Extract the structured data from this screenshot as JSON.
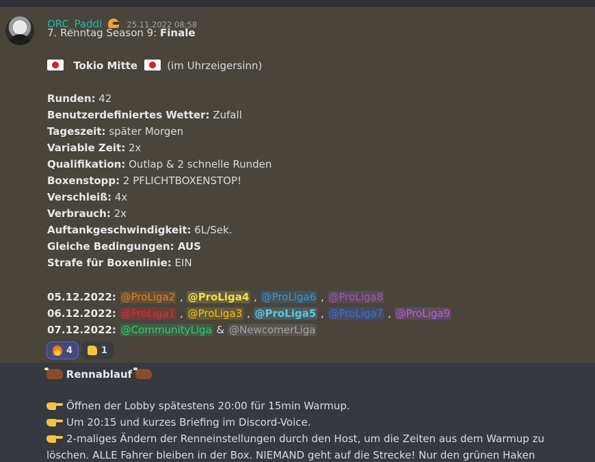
{
  "message1": {
    "username": "ORC_Paddi",
    "timestamp": "25.11.2022 08:58",
    "title_prefix": "7. Renntag Season 9: ",
    "title_bold": "Finale",
    "track": "Tokio Mitte",
    "direction": "(im Uhrzeigersinn)",
    "settings": [
      {
        "label": "Runden:",
        "value": " 42",
        "bold_value": false
      },
      {
        "label": "Benutzerdefiniertes Wetter:",
        "value": " Zufall",
        "bold_value": false
      },
      {
        "label": "Tageszeit:",
        "value": " später Morgen",
        "bold_value": false
      },
      {
        "label": "Variable Zeit:",
        "value": " 2x",
        "bold_value": false
      },
      {
        "label": "Qualifikation:",
        "value": " Outlap & 2 schnelle Runden",
        "bold_value": false
      },
      {
        "label": "Boxenstopp:",
        "value": " 2 PFLICHTBOXENSTOP!",
        "bold_value": false
      },
      {
        "label": "Verschleiß:",
        "value": " 4x",
        "bold_value": false
      },
      {
        "label": "Verbrauch:",
        "value": " 2x",
        "bold_value": false
      },
      {
        "label": "Auftankgeschwindigkeit:",
        "value": " 6L/Sek.",
        "bold_value": false
      },
      {
        "label": "Gleiche Bedingungen:",
        "value": " AUS",
        "bold_value": true
      },
      {
        "label": "Strafe für Boxenlinie:",
        "value": " EIN",
        "bold_value": false
      }
    ],
    "schedule": [
      {
        "date": "05.12.2022:",
        "mentions": [
          "@ProLiga2",
          "@ProLiga4",
          "@ProLiga6",
          "@ProLiga8"
        ]
      },
      {
        "date": "06.12.2022:",
        "mentions": [
          "@ProLiga1",
          "@ProLiga3",
          "@ProLiga5",
          "@ProLiga7",
          "@ProLiga9"
        ]
      },
      {
        "date": "07.12.2022:",
        "mentions": [
          "@CommunityLiga",
          "@NewcomerLiga"
        ]
      }
    ],
    "separator": ",",
    "and": "&",
    "reactions": [
      {
        "emoji": "fire",
        "count": "4",
        "active": true
      },
      {
        "emoji": "thumbs-up",
        "count": "1",
        "active": false
      }
    ]
  },
  "message2": {
    "heading": "Rennablauf",
    "lines": [
      "Öffnen der Lobby spätestens 20:00 für 15min Warmup.",
      "Um 20:15 und kurzes Briefing im Discord-Voice.",
      "2-maliges Ändern der Renneinstellungen durch den Host, um die Zeiten aus dem Warmup zu",
      "löschen. ALLE Fahrer bleiben in der Box. NIEMAND geht auf die Strecke! Nur den grünen Haken"
    ]
  },
  "colors": {
    "background": "#36393f",
    "highlight_background": "#49443c",
    "username": "#1fbc9c"
  }
}
